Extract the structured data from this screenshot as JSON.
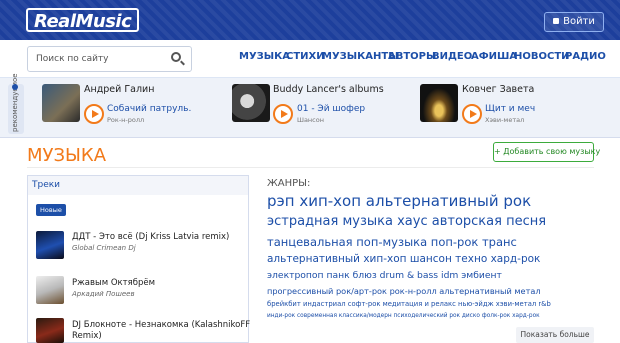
{
  "header": {
    "logo": "RealMusic",
    "login_label": "Войти"
  },
  "search": {
    "placeholder": "Поиск по сайту"
  },
  "nav": [
    "МУЗЫКА",
    "СТИХИ",
    "МУЗЫКАНТЫ",
    "АВТОРЫ",
    "ВИДЕО",
    "АФИША",
    "НОВОСТИ",
    "РАДИО"
  ],
  "player_strip": {
    "side_label": "рекомендуемое",
    "cards": [
      {
        "name": "Андрей Галин",
        "track": "Собачий патруль.",
        "genre": "Рок-н-ролл"
      },
      {
        "name": "Buddy Lancer's albums",
        "track": "01 - Эй шофер",
        "genre": "Шансон"
      },
      {
        "name": "Ковчег Завета",
        "track": "Щит и меч",
        "genre": "Хэви-метал"
      }
    ]
  },
  "section": {
    "title": "МУЗЫКА",
    "add_label": "+ Добавить свою музыку"
  },
  "tracks": {
    "tab_label": "Треки",
    "filter_label": "Новые",
    "items": [
      {
        "title": "ДДТ - Это всё (Dj Kriss Latvia remix)",
        "artist": "Global Crimean Dj"
      },
      {
        "title": "Ржавым Октябрём",
        "artist": "Аркадий Пошеев"
      },
      {
        "title": "DJ Блокнотe - Незнакомка (KalashnikoFF",
        "title2": "Remix)",
        "artist": ""
      }
    ]
  },
  "genres": {
    "title": "ЖАНРЫ:",
    "lines": [
      "рэп хип-хоп альтернативный рок",
      "эстрадная музыка хаус авторская песня",
      "танцевальная поп-музыка поп-рок транс",
      "альтернативный хип-хоп шансон техно хард-рок",
      "электропоп панк блюз drum & bass idm эмбиент",
      "прогрессивный рок/арт-рок рок-н-ролл альтернативный метал",
      "брейкбит индастриал софт-рок медитация и релакс нью-эйдж хэви-метал r&b",
      "инди-рок современная классика/модерн психоделический рок диско фолк-рок хард-рок"
    ],
    "more_label": "Показать больше"
  },
  "colors": {
    "header_bg": "#1d3f9c",
    "accent_orange": "#f27a1a",
    "link_blue": "#1d4fa8",
    "add_green": "#3cab3c"
  }
}
